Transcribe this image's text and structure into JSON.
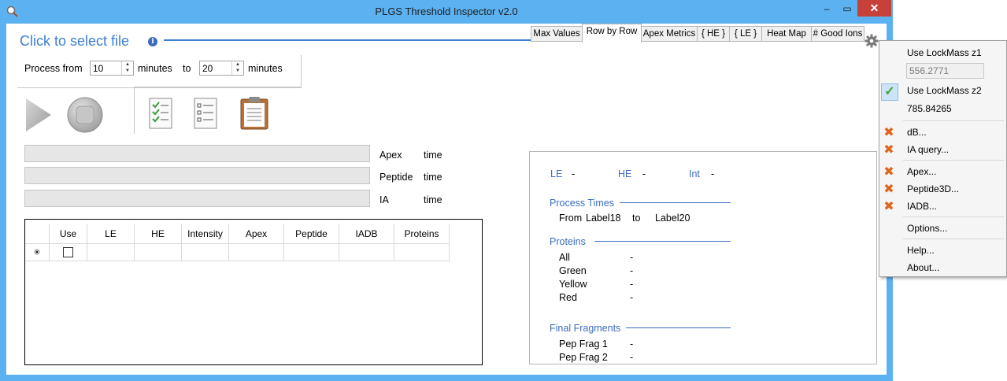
{
  "window": {
    "title": "PLGS Threshold Inspector v2.0",
    "min": "–",
    "max": "▭",
    "close": "✕"
  },
  "header": {
    "select_file": "Click to select file",
    "info": "i"
  },
  "process": {
    "from_label": "Process from",
    "from_value": "10",
    "minutes1": "minutes",
    "to_label": "to",
    "to_value": "20",
    "minutes2": "minutes"
  },
  "progress": [
    {
      "label": "Apex",
      "time": "time"
    },
    {
      "label": "Peptide",
      "time": "time"
    },
    {
      "label": "IA",
      "time": "time"
    }
  ],
  "grid": {
    "columns": [
      "Use",
      "LE",
      "HE",
      "Intensity",
      "Apex",
      "Peptide",
      "IADB",
      "Proteins"
    ],
    "new_row_marker": "✳"
  },
  "tabs": [
    "Max Values",
    "Row by Row",
    "Apex Metrics",
    "{ HE }",
    "{ LE }",
    "Heat Map",
    "# Good Ions"
  ],
  "active_tab": "Row by Row",
  "panel": {
    "le_label": "LE",
    "le_value": "-",
    "he_label": "HE",
    "he_value": "-",
    "int_label": "Int",
    "int_value": "-",
    "process_times": "Process Times",
    "from_label": "From",
    "from_value": "Label18",
    "to_label": "to",
    "to_value": "Label20",
    "proteins_title": "Proteins",
    "proteins": [
      {
        "label": "All",
        "value": "-"
      },
      {
        "label": "Green",
        "value": "-"
      },
      {
        "label": "Yellow",
        "value": "-"
      },
      {
        "label": "Red",
        "value": "-"
      }
    ],
    "final_fragments": "Final Fragments",
    "fragments": [
      {
        "label": "Pep Frag 1",
        "value": "-"
      },
      {
        "label": "Pep Frag 2",
        "value": "-"
      }
    ]
  },
  "menu": {
    "lockmass_z1": "Use LockMass z1",
    "lockmass_z1_value": "556.2771",
    "lockmass_z2": "Use LockMass z2",
    "lockmass_z2_value": "785.84265",
    "items_a": [
      "dB...",
      "IA query..."
    ],
    "items_b": [
      "Apex...",
      "Peptide3D...",
      "IADB..."
    ],
    "options": "Options...",
    "help": "Help...",
    "about": "About..."
  },
  "colors": {
    "titlebar": "#5cb1f0",
    "accent": "#3c7fd0",
    "close": "#c7413b",
    "error_x": "#e0641e"
  }
}
